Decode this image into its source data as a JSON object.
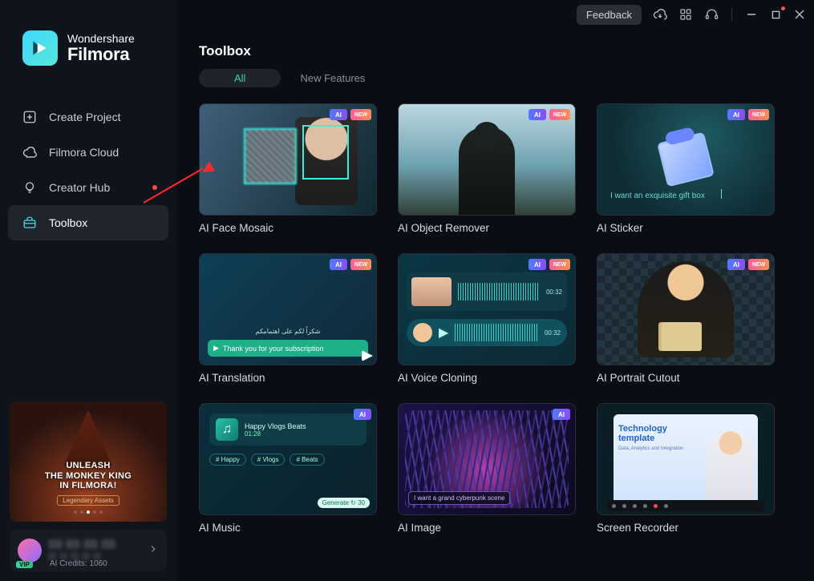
{
  "titlebar": {
    "feedback": "Feedback"
  },
  "brand": {
    "line1": "Wondershare",
    "line2": "Filmora"
  },
  "sidebar": {
    "items": [
      {
        "label": "Create Project"
      },
      {
        "label": "Filmora Cloud"
      },
      {
        "label": "Creator Hub"
      },
      {
        "label": "Toolbox"
      }
    ]
  },
  "promo": {
    "title_l1": "UNLEASH",
    "title_l2": "THE MONKEY KING",
    "title_l3": "IN FILMORA!",
    "subtitle": "Legendary Assets"
  },
  "user": {
    "credits": "AI Credits: 1060",
    "vip": "VIP"
  },
  "page": {
    "title": "Toolbox",
    "tab_all": "All",
    "tab_new": "New Features"
  },
  "badges": {
    "ai": "AI",
    "new": "NEW"
  },
  "cards": [
    {
      "title": "AI Face Mosaic"
    },
    {
      "title": "AI Object Remover"
    },
    {
      "title": "AI Sticker",
      "caption": "I want an exquisite gift box"
    },
    {
      "title": "AI Translation",
      "sub_text": "Thank you for your subscription"
    },
    {
      "title": "AI Voice Cloning",
      "time1": "00:32",
      "time2": "00:32"
    },
    {
      "title": "AI Portrait Cutout"
    },
    {
      "title": "AI Music",
      "track": "Happy Vlogs Beats",
      "dur": "01:28",
      "chips": [
        "# Happy",
        "# Vlogs",
        "# Beats"
      ],
      "gen": "Generate ↻ 30"
    },
    {
      "title": "AI Image",
      "caption": "I want a grand cyberpunk scene"
    },
    {
      "title": "Screen Recorder",
      "tmpl_t": "Technology template",
      "tmpl_s": "Data, Analytics and Integration"
    }
  ]
}
